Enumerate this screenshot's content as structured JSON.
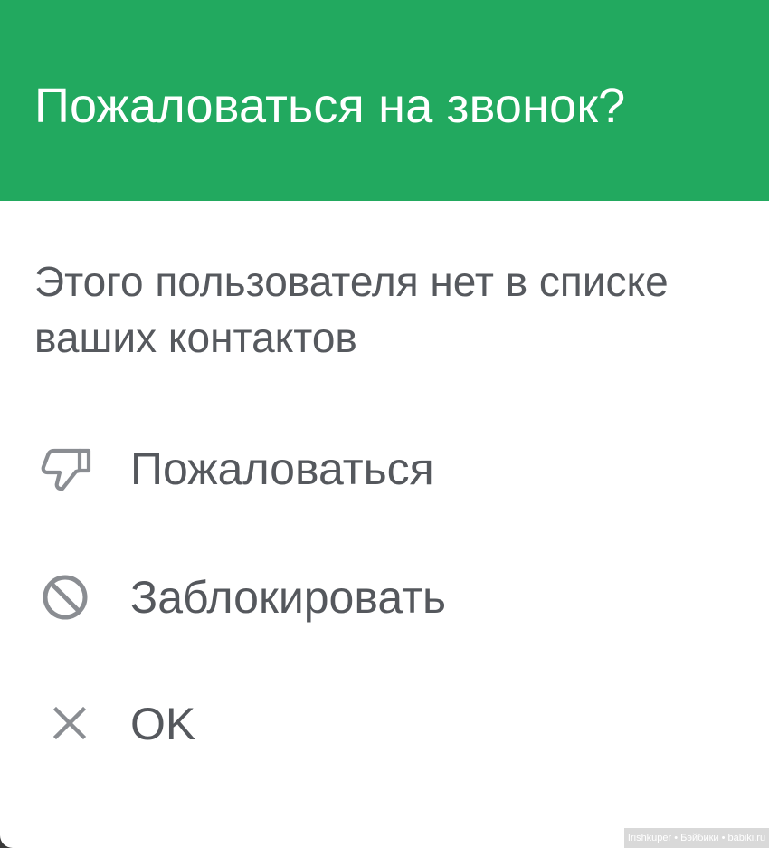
{
  "dialog": {
    "title": "Пожаловаться на звонок?",
    "message": "Этого пользователя нет в списке ваших контактов",
    "header_color": "#22a95f",
    "options": [
      {
        "label": "Пожаловаться",
        "icon": "thumbs-down-icon"
      },
      {
        "label": "Заблокировать",
        "icon": "block-icon"
      },
      {
        "label": "OK",
        "icon": "close-icon"
      }
    ]
  },
  "watermark": "Irishkuper • Бэйбики • babiki.ru"
}
